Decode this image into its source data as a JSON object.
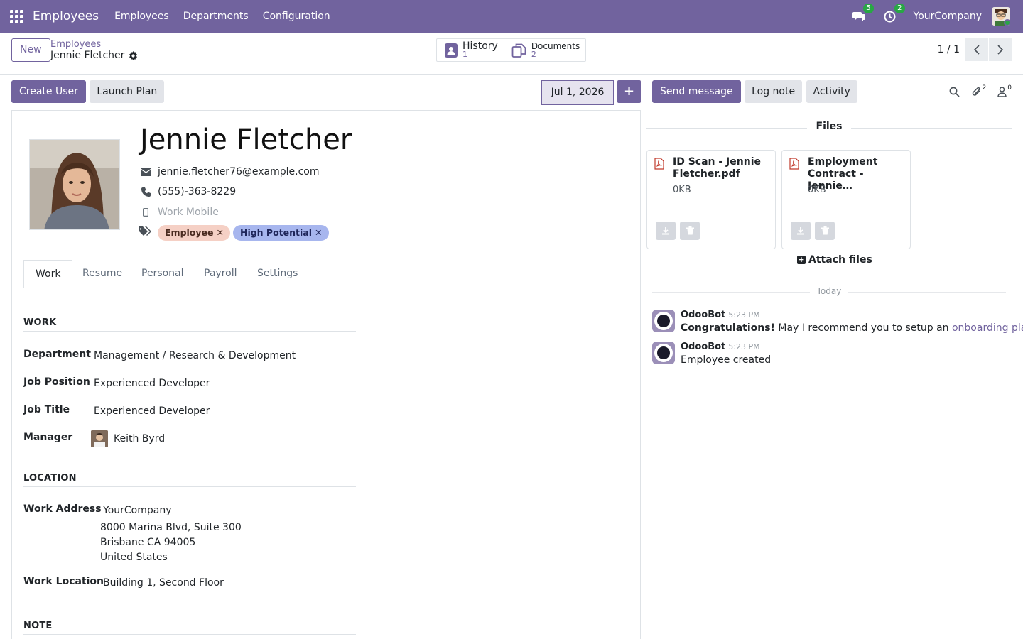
{
  "nav": {
    "brand": "Employees",
    "menu": [
      "Employees",
      "Departments",
      "Configuration"
    ],
    "messages_count": "5",
    "activities_count": "2",
    "company": "YourCompany"
  },
  "control": {
    "new_label": "New",
    "breadcrumb_parent": "Employees",
    "breadcrumb_current": "Jennie Fletcher",
    "smart_buttons": [
      {
        "label": "History",
        "count": "1"
      },
      {
        "label": "Documents",
        "count": "2"
      }
    ],
    "pager": "1 / 1"
  },
  "statusbar": {
    "create_user": "Create User",
    "launch_plan": "Launch Plan",
    "date": "Jul 1, 2026"
  },
  "employee": {
    "name": "Jennie Fletcher",
    "email": "jennie.fletcher76@example.com",
    "phone": "(555)-363-8229",
    "mobile_placeholder": "Work Mobile",
    "tags": [
      "Employee",
      "High Potential"
    ]
  },
  "tabs": [
    "Work",
    "Resume",
    "Personal",
    "Payroll",
    "Settings"
  ],
  "work": {
    "section": "WORK",
    "department_label": "Department",
    "department": "Management / Research & Development",
    "job_position_label": "Job Position",
    "job_position": "Experienced Developer",
    "job_title_label": "Job Title",
    "job_title": "Experienced Developer",
    "manager_label": "Manager",
    "manager": "Keith Byrd"
  },
  "location": {
    "section": "LOCATION",
    "address_label": "Work Address",
    "address_company": "YourCompany",
    "address_line1": "8000 Marina Blvd, Suite 300",
    "address_line2": "Brisbane CA 94005",
    "address_line3": "United States",
    "location_label": "Work Location",
    "location": "Building 1, Second Floor"
  },
  "note": {
    "section": "NOTE"
  },
  "chatter": {
    "send_message": "Send message",
    "log_note": "Log note",
    "activity": "Activity",
    "attachments_count": "2",
    "followers_count": "0",
    "files_title": "Files",
    "files": [
      {
        "name": "ID Scan - Jennie Fletcher.pdf",
        "size": "0KB"
      },
      {
        "name": "Employment Contract - Jennie…",
        "size": "0KB"
      }
    ],
    "attach_label": "Attach files",
    "today": "Today",
    "messages": [
      {
        "author": "OdooBot",
        "time": "5:23 PM",
        "bold": "Congratulations!",
        "text": " May I recommend you to setup an ",
        "link": "onboarding plan?"
      },
      {
        "author": "OdooBot",
        "time": "5:23 PM",
        "text": "Employee created"
      }
    ]
  },
  "colors": {
    "brand": "#71639e",
    "tag_employee": "#f5d0c5",
    "tag_high_potential": "#a7b6ee",
    "badge": "#28a745"
  }
}
